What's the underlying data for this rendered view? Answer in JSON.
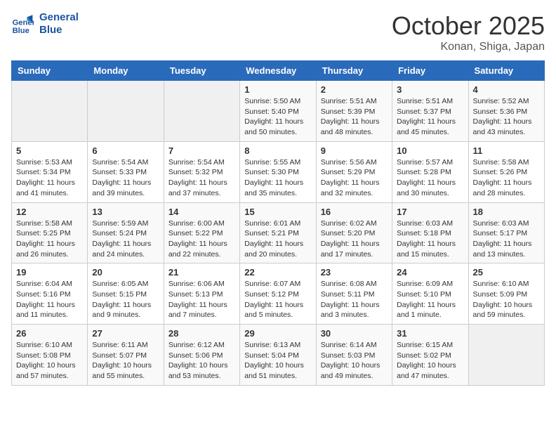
{
  "header": {
    "logo_line1": "General",
    "logo_line2": "Blue",
    "month": "October 2025",
    "location": "Konan, Shiga, Japan"
  },
  "days_of_week": [
    "Sunday",
    "Monday",
    "Tuesday",
    "Wednesday",
    "Thursday",
    "Friday",
    "Saturday"
  ],
  "weeks": [
    [
      {
        "day": "",
        "info": ""
      },
      {
        "day": "",
        "info": ""
      },
      {
        "day": "",
        "info": ""
      },
      {
        "day": "1",
        "info": "Sunrise: 5:50 AM\nSunset: 5:40 PM\nDaylight: 11 hours\nand 50 minutes."
      },
      {
        "day": "2",
        "info": "Sunrise: 5:51 AM\nSunset: 5:39 PM\nDaylight: 11 hours\nand 48 minutes."
      },
      {
        "day": "3",
        "info": "Sunrise: 5:51 AM\nSunset: 5:37 PM\nDaylight: 11 hours\nand 45 minutes."
      },
      {
        "day": "4",
        "info": "Sunrise: 5:52 AM\nSunset: 5:36 PM\nDaylight: 11 hours\nand 43 minutes."
      }
    ],
    [
      {
        "day": "5",
        "info": "Sunrise: 5:53 AM\nSunset: 5:34 PM\nDaylight: 11 hours\nand 41 minutes."
      },
      {
        "day": "6",
        "info": "Sunrise: 5:54 AM\nSunset: 5:33 PM\nDaylight: 11 hours\nand 39 minutes."
      },
      {
        "day": "7",
        "info": "Sunrise: 5:54 AM\nSunset: 5:32 PM\nDaylight: 11 hours\nand 37 minutes."
      },
      {
        "day": "8",
        "info": "Sunrise: 5:55 AM\nSunset: 5:30 PM\nDaylight: 11 hours\nand 35 minutes."
      },
      {
        "day": "9",
        "info": "Sunrise: 5:56 AM\nSunset: 5:29 PM\nDaylight: 11 hours\nand 32 minutes."
      },
      {
        "day": "10",
        "info": "Sunrise: 5:57 AM\nSunset: 5:28 PM\nDaylight: 11 hours\nand 30 minutes."
      },
      {
        "day": "11",
        "info": "Sunrise: 5:58 AM\nSunset: 5:26 PM\nDaylight: 11 hours\nand 28 minutes."
      }
    ],
    [
      {
        "day": "12",
        "info": "Sunrise: 5:58 AM\nSunset: 5:25 PM\nDaylight: 11 hours\nand 26 minutes."
      },
      {
        "day": "13",
        "info": "Sunrise: 5:59 AM\nSunset: 5:24 PM\nDaylight: 11 hours\nand 24 minutes."
      },
      {
        "day": "14",
        "info": "Sunrise: 6:00 AM\nSunset: 5:22 PM\nDaylight: 11 hours\nand 22 minutes."
      },
      {
        "day": "15",
        "info": "Sunrise: 6:01 AM\nSunset: 5:21 PM\nDaylight: 11 hours\nand 20 minutes."
      },
      {
        "day": "16",
        "info": "Sunrise: 6:02 AM\nSunset: 5:20 PM\nDaylight: 11 hours\nand 17 minutes."
      },
      {
        "day": "17",
        "info": "Sunrise: 6:03 AM\nSunset: 5:18 PM\nDaylight: 11 hours\nand 15 minutes."
      },
      {
        "day": "18",
        "info": "Sunrise: 6:03 AM\nSunset: 5:17 PM\nDaylight: 11 hours\nand 13 minutes."
      }
    ],
    [
      {
        "day": "19",
        "info": "Sunrise: 6:04 AM\nSunset: 5:16 PM\nDaylight: 11 hours\nand 11 minutes."
      },
      {
        "day": "20",
        "info": "Sunrise: 6:05 AM\nSunset: 5:15 PM\nDaylight: 11 hours\nand 9 minutes."
      },
      {
        "day": "21",
        "info": "Sunrise: 6:06 AM\nSunset: 5:13 PM\nDaylight: 11 hours\nand 7 minutes."
      },
      {
        "day": "22",
        "info": "Sunrise: 6:07 AM\nSunset: 5:12 PM\nDaylight: 11 hours\nand 5 minutes."
      },
      {
        "day": "23",
        "info": "Sunrise: 6:08 AM\nSunset: 5:11 PM\nDaylight: 11 hours\nand 3 minutes."
      },
      {
        "day": "24",
        "info": "Sunrise: 6:09 AM\nSunset: 5:10 PM\nDaylight: 11 hours\nand 1 minute."
      },
      {
        "day": "25",
        "info": "Sunrise: 6:10 AM\nSunset: 5:09 PM\nDaylight: 10 hours\nand 59 minutes."
      }
    ],
    [
      {
        "day": "26",
        "info": "Sunrise: 6:10 AM\nSunset: 5:08 PM\nDaylight: 10 hours\nand 57 minutes."
      },
      {
        "day": "27",
        "info": "Sunrise: 6:11 AM\nSunset: 5:07 PM\nDaylight: 10 hours\nand 55 minutes."
      },
      {
        "day": "28",
        "info": "Sunrise: 6:12 AM\nSunset: 5:06 PM\nDaylight: 10 hours\nand 53 minutes."
      },
      {
        "day": "29",
        "info": "Sunrise: 6:13 AM\nSunset: 5:04 PM\nDaylight: 10 hours\nand 51 minutes."
      },
      {
        "day": "30",
        "info": "Sunrise: 6:14 AM\nSunset: 5:03 PM\nDaylight: 10 hours\nand 49 minutes."
      },
      {
        "day": "31",
        "info": "Sunrise: 6:15 AM\nSunset: 5:02 PM\nDaylight: 10 hours\nand 47 minutes."
      },
      {
        "day": "",
        "info": ""
      }
    ]
  ]
}
